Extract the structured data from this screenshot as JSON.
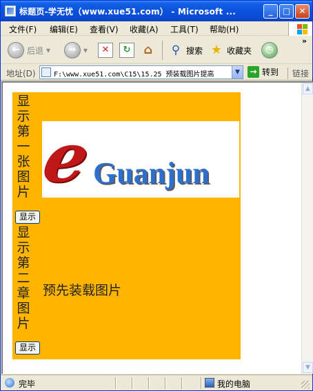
{
  "window": {
    "title": "标题页-学无忧（www.xue51.com） - Microsoft ...",
    "minimize_glyph": "_",
    "maximize_glyph": "□",
    "close_glyph": "✕"
  },
  "menu": [
    "文件(F)",
    "编辑(E)",
    "查看(V)",
    "收藏(A)",
    "工具(T)",
    "帮助(H)"
  ],
  "toolbar": {
    "back_label": "后退",
    "search_label": "搜索",
    "favorites_label": "收藏夹",
    "more_glyph": "»"
  },
  "address": {
    "label": "地址(D)",
    "url": "F:\\www.xue51.com\\C15\\15.25  预装载图片提高",
    "go_label": "转到",
    "links_label": "链接"
  },
  "page": {
    "text1_chars": [
      "显",
      "示",
      "第",
      "一",
      "张",
      "图",
      "片"
    ],
    "button1_label": "显示",
    "text2_chars": [
      "显",
      "示",
      "第",
      "二",
      "章",
      "图",
      "片"
    ],
    "button2_label": "显示",
    "logo_letter": "e",
    "logo_text": "Guanjun",
    "preload_text": "预先装载图片"
  },
  "status": {
    "text": "完毕",
    "zone": "我的电脑"
  },
  "colors": {
    "panel": "#ffb400",
    "titlebar": "#0a52dd"
  }
}
